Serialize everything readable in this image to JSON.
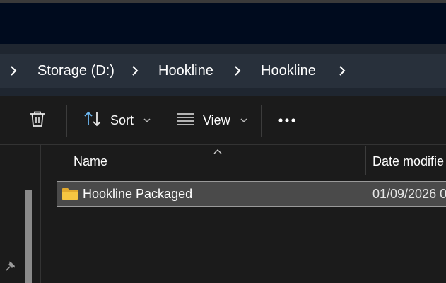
{
  "address": {
    "crumbs": [
      "Storage (D:)",
      "Hookline",
      "Hookline"
    ]
  },
  "toolbar": {
    "sort_label": "Sort",
    "view_label": "View",
    "icons": [
      "trash-icon",
      "sort-icon",
      "view-icon",
      "more-icon"
    ]
  },
  "columns": {
    "name": "Name",
    "date": "Date modifie"
  },
  "files": [
    {
      "name": "Hookline Packaged",
      "date": "01/09/2026 0",
      "type": "folder",
      "selected": true
    }
  ],
  "colors": {
    "title_bg": "#000b1e",
    "address_bg": "#28303b",
    "selection_bg": "#4a4a4a",
    "folder": "#f5c542"
  }
}
